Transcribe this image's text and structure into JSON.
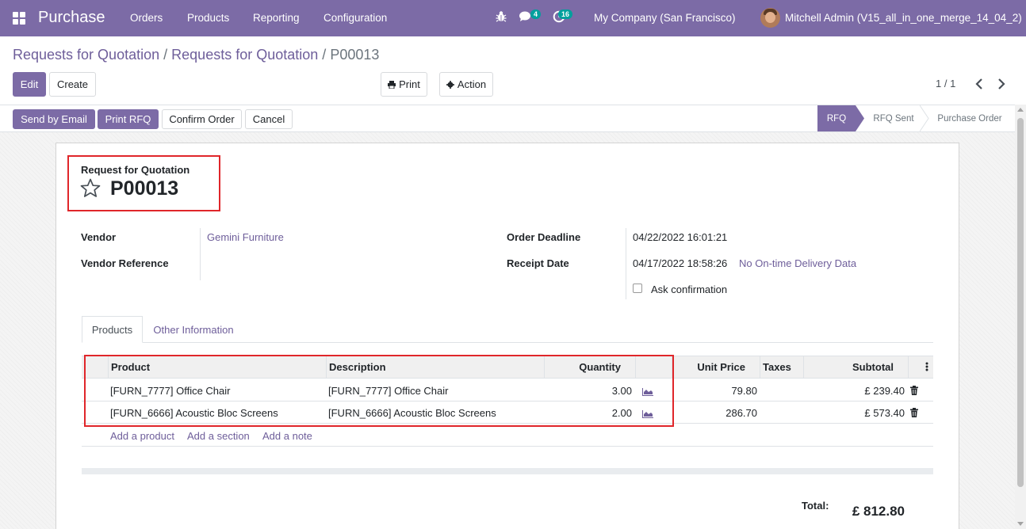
{
  "navbar": {
    "brand": "Purchase",
    "menu": [
      "Orders",
      "Products",
      "Reporting",
      "Configuration"
    ],
    "chat_count": "4",
    "activity_count": "16",
    "company": "My Company (San Francisco)",
    "user": "Mitchell Admin (V15_all_in_one_merge_14_04_2)"
  },
  "breadcrumb": {
    "parent1": "Requests for Quotation",
    "parent2": "Requests for Quotation",
    "current": "P00013",
    "sep": "/"
  },
  "buttons": {
    "edit": "Edit",
    "create": "Create",
    "print": "Print",
    "action": "Action"
  },
  "pager": {
    "value": "1 / 1"
  },
  "statusbar": {
    "send_email": "Send by Email",
    "print_rfq": "Print RFQ",
    "confirm": "Confirm Order",
    "cancel": "Cancel",
    "stages": [
      "RFQ",
      "RFQ Sent",
      "Purchase Order"
    ],
    "active_stage": "RFQ"
  },
  "form": {
    "doc_type": "Request for Quotation",
    "name": "P00013",
    "vendor_label": "Vendor",
    "vendor_value": "Gemini Furniture",
    "vendor_ref_label": "Vendor Reference",
    "deadline_label": "Order Deadline",
    "deadline_value": "04/22/2022 16:01:21",
    "receipt_label": "Receipt Date",
    "receipt_value": "04/17/2022 18:58:26",
    "ontime_link": "No On-time Delivery Data",
    "ask_confirmation": "Ask confirmation"
  },
  "tabs": [
    "Products",
    "Other Information"
  ],
  "table": {
    "headers": {
      "product": "Product",
      "description": "Description",
      "quantity": "Quantity",
      "unit_price": "Unit Price",
      "taxes": "Taxes",
      "subtotal": "Subtotal"
    },
    "rows": [
      {
        "product": "[FURN_7777] Office Chair",
        "description": "[FURN_7777] Office Chair",
        "quantity": "3.00",
        "unit_price": "79.80",
        "taxes": "",
        "subtotal": "£ 239.40"
      },
      {
        "product": "[FURN_6666] Acoustic Bloc Screens",
        "description": "[FURN_6666] Acoustic Bloc Screens",
        "quantity": "2.00",
        "unit_price": "286.70",
        "taxes": "",
        "subtotal": "£ 573.40"
      }
    ],
    "add_product": "Add a product",
    "add_section": "Add a section",
    "add_note": "Add a note"
  },
  "totals": {
    "label": "Total:",
    "value": "£ 812.80"
  },
  "colors": {
    "brand": "#7c6ba6",
    "link": "#6e5e9a",
    "highlight": "#e0262a",
    "badge": "#00a09d"
  }
}
